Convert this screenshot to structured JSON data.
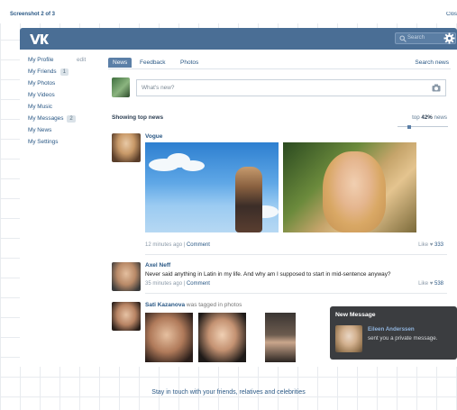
{
  "screenshot_label": "Screenshot 2 of 3",
  "close_label": "Close",
  "header": {
    "search_placeholder": "Search"
  },
  "sidebar": {
    "items": [
      {
        "label": "My Profile",
        "edit": "edit"
      },
      {
        "label": "My Friends",
        "badge": "1"
      },
      {
        "label": "My Photos"
      },
      {
        "label": "My Videos"
      },
      {
        "label": "My Music"
      },
      {
        "label": "My Messages",
        "badge": "2"
      },
      {
        "label": "My News"
      },
      {
        "label": "My Settings"
      }
    ]
  },
  "tabs": [
    "News",
    "Feedback",
    "Photos"
  ],
  "tab_right": "Search news",
  "composer": {
    "placeholder": "What's new?"
  },
  "feed": {
    "heading": "Showing top news",
    "top_prefix": "top",
    "top_percent": "42%",
    "top_suffix": "news",
    "top_slider_fraction": 0.42
  },
  "posts": [
    {
      "author": "Vogue",
      "time": "12 minutes ago",
      "comment": "Comment",
      "like_label": "Like",
      "likes": "333"
    },
    {
      "author": "Axel Neff",
      "text": "Never said anything in Latin in my life. And why am I supposed to start in mid-sentence anyway?",
      "time": "35 minutes ago",
      "comment": "Comment",
      "like_label": "Like",
      "likes": "538"
    },
    {
      "author": "Sati Kazanova",
      "action": "was tagged in photos"
    }
  ],
  "notification": {
    "title": "New Message",
    "sender": "Eileen Anderssen",
    "text": "sent you a private message."
  },
  "tagline": "Stay in touch with your friends, relatives and celebrities",
  "colors": {
    "header": "#4a6e95",
    "link": "#2a5885",
    "notification_bg": "#3b3d40"
  }
}
